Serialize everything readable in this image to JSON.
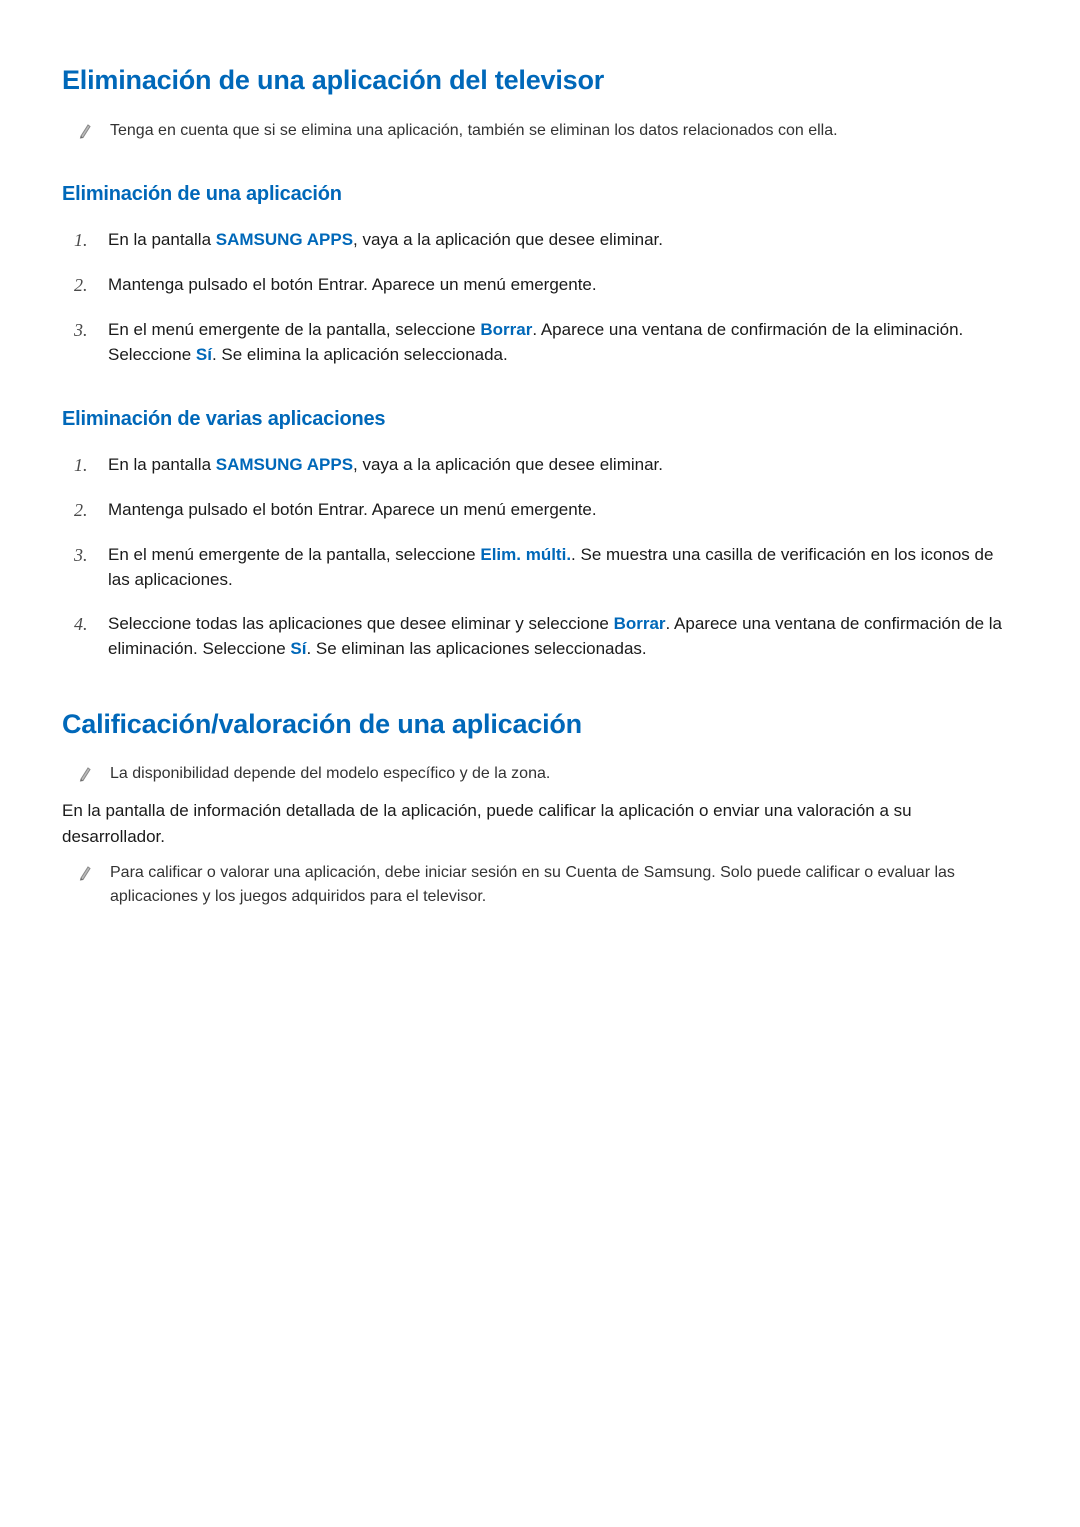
{
  "section1": {
    "title": "Eliminación de una aplicación del televisor",
    "note": "Tenga en cuenta que si se elimina una aplicación, también se eliminan los datos relacionados con ella.",
    "sub1": {
      "title": "Eliminación de una aplicación",
      "steps": {
        "s1_pre": "En la pantalla ",
        "s1_bold": "SAMSUNG APPS",
        "s1_post": ", vaya a la aplicación que desee eliminar.",
        "s2": "Mantenga pulsado el botón Entrar. Aparece un menú emergente.",
        "s3_pre": "En el menú emergente de la pantalla, seleccione ",
        "s3_bold1": "Borrar",
        "s3_mid": ". Aparece una ventana de confirmación de la eliminación. Seleccione ",
        "s3_bold2": "Sí",
        "s3_post": ". Se elimina la aplicación seleccionada."
      }
    },
    "sub2": {
      "title": "Eliminación de varias aplicaciones",
      "steps": {
        "s1_pre": "En la pantalla ",
        "s1_bold": "SAMSUNG APPS",
        "s1_post": ", vaya a la aplicación que desee eliminar.",
        "s2": "Mantenga pulsado el botón Entrar. Aparece un menú emergente.",
        "s3_pre": "En el menú emergente de la pantalla, seleccione ",
        "s3_bold": "Elim. múlti.",
        "s3_post": ". Se muestra una casilla de verificación en los iconos de las aplicaciones.",
        "s4_pre": "Seleccione todas las aplicaciones que desee eliminar y seleccione ",
        "s4_bold1": "Borrar",
        "s4_mid": ". Aparece una ventana de confirmación de la eliminación. Seleccione ",
        "s4_bold2": "Sí",
        "s4_post": ". Se eliminan las aplicaciones seleccionadas."
      }
    }
  },
  "section2": {
    "title": "Calificación/valoración de una aplicación",
    "note1": "La disponibilidad depende del modelo específico y de la zona.",
    "body": "En la pantalla de información detallada de la aplicación, puede calificar la aplicación o enviar una valoración a su desarrollador.",
    "note2": "Para calificar o valorar una aplicación, debe iniciar sesión en su Cuenta de Samsung. Solo puede calificar o evaluar las aplicaciones y los juegos adquiridos para el televisor."
  },
  "numbers": {
    "n1": "1.",
    "n2": "2.",
    "n3": "3.",
    "n4": "4."
  }
}
